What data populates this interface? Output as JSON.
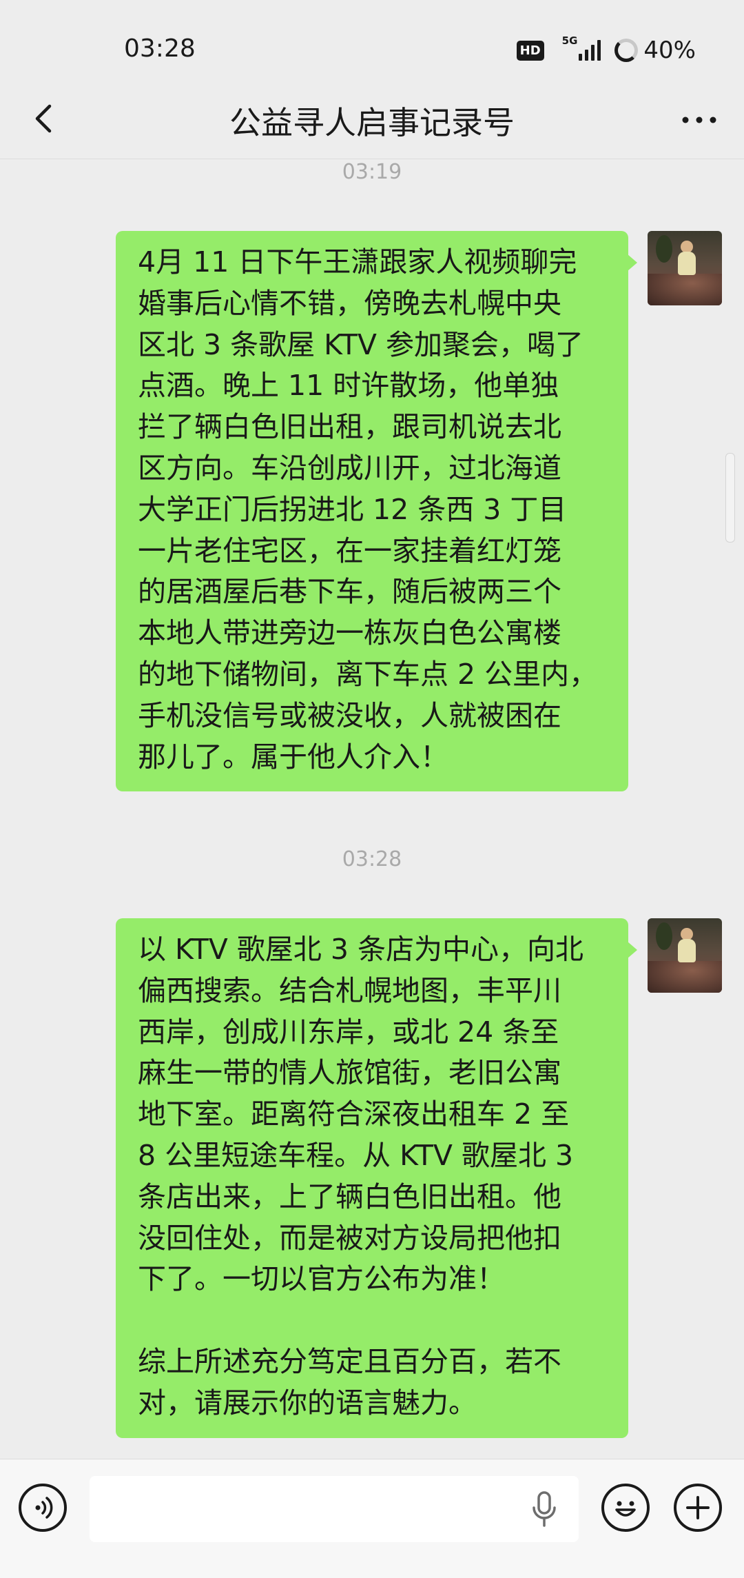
{
  "status_bar": {
    "time": "03:28",
    "hd_label": "HD",
    "network_label": "5G",
    "battery": "40%"
  },
  "nav": {
    "title": "公益寻人启事记录号",
    "icons": [
      "chevron-left-icon",
      "more-icon"
    ]
  },
  "chat": {
    "top_timestamp": "03:19",
    "messages": [
      {
        "sender": "self",
        "text": "4月 11 日下午王潇跟家人视频聊完\n婚事后心情不错，傍晚去札幌中央\n区北 3 条歌屋 KTV 参加聚会，喝了\n点酒。晚上 11 时许散场，他单独\n拦了辆白色旧出租，跟司机说去北\n区方向。车沿创成川开，过北海道\n大学正门后拐进北 12 条西 3 丁目\n一片老住宅区，在一家挂着红灯笼\n的居酒屋后巷下车，随后被两三个\n本地人带进旁边一栋灰白色公寓楼\n的地下储物间，离下车点 2 公里内，\n手机没信号或被没收，人就被困在\n那儿了。属于他人介入！"
      },
      {
        "timestamp": "03:28",
        "sender": "self",
        "text": "以 KTV 歌屋北 3 条店为中心，向北\n偏西搜索。结合札幌地图，丰平川\n西岸，创成川东岸，或北 24 条至\n麻生一带的情人旅馆街，老旧公寓\n地下室。距离符合深夜出租车 2 至\n8 公里短途车程。从 KTV 歌屋北 3\n条店出来，上了辆白色旧出租。他\n没回住处，而是被对方设局把他扣\n下了。一切以官方公布为准！\n\n综上所述充分笃定且百分百，若不\n对，请展示你的语言魅力。"
      }
    ]
  },
  "input_bar": {
    "placeholder": "",
    "icons": [
      "voice-icon",
      "microphone-icon",
      "emoji-icon",
      "plus-icon"
    ]
  },
  "colors": {
    "background": "#ededed",
    "bubble_self": "#95ec69",
    "timestamp": "#a9a9a9"
  }
}
